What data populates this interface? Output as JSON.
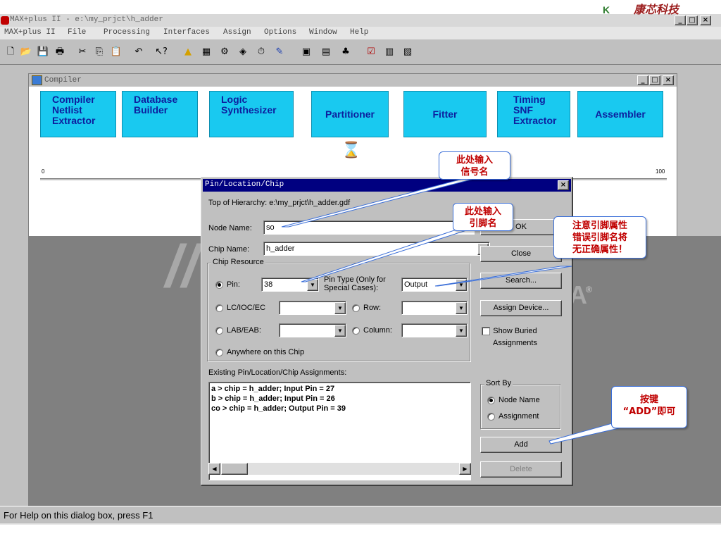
{
  "app": {
    "title": "MAX+plus II - e:\\my_prjct\\h_adder",
    "brand": "康芯科技",
    "brand_mark": "K"
  },
  "menu": [
    "MAX+plus II",
    "File",
    "Processing",
    "Interfaces",
    "Assign",
    "Options",
    "Window",
    "Help"
  ],
  "toolbar_icons": [
    {
      "name": "new-file-icon",
      "glyph": "🗋"
    },
    {
      "name": "open-folder-icon",
      "glyph": "📂"
    },
    {
      "name": "save-icon",
      "glyph": "💾"
    },
    {
      "name": "print-icon",
      "glyph": "🖶"
    },
    {
      "name": "cut-icon",
      "glyph": "✂"
    },
    {
      "name": "copy-icon",
      "glyph": "⎘"
    },
    {
      "name": "paste-icon",
      "glyph": "📋"
    },
    {
      "name": "undo-icon",
      "glyph": "↶"
    },
    {
      "name": "context-help-icon",
      "glyph": "↖?"
    },
    {
      "name": "hierarchy-icon",
      "glyph": "▲"
    },
    {
      "name": "floorplan-icon",
      "glyph": "▦"
    },
    {
      "name": "compiler-icon",
      "glyph": "⚙"
    },
    {
      "name": "simulator-icon",
      "glyph": "◈"
    },
    {
      "name": "timing-analyzer-icon",
      "glyph": "⏱"
    },
    {
      "name": "programmer-icon",
      "glyph": "✎"
    },
    {
      "name": "project-set-icon",
      "glyph": "▣"
    },
    {
      "name": "project-save-check-icon",
      "glyph": "▤"
    },
    {
      "name": "project-save-compile-icon",
      "glyph": "♣"
    },
    {
      "name": "project-save-simulate-icon",
      "glyph": "☑"
    },
    {
      "name": "project-open-icon",
      "glyph": "▥"
    },
    {
      "name": "project-close-icon",
      "glyph": "▧"
    }
  ],
  "compiler": {
    "title": "Compiler",
    "stages": [
      {
        "label": "Compiler\nNetlist\nExtractor"
      },
      {
        "label": "Database\nBuilder"
      },
      {
        "label": "Logic\nSynthesizer"
      },
      {
        "label": "Partitioner"
      },
      {
        "label": "Fitter"
      },
      {
        "label": "Timing\nSNF\nExtractor"
      },
      {
        "label": "Assembler"
      }
    ],
    "progress_min": "0",
    "progress_max": "100",
    "hourglass": "⌛"
  },
  "dialog": {
    "title": "Pin/Location/Chip",
    "top_of_hierarchy": "Top of Hierarchy:  e:\\my_prjct\\h_adder.gdf",
    "node_name_label": "Node Name:",
    "node_name_value": "so",
    "chip_name_label": "Chip Name:",
    "chip_name_value": "h_adder",
    "chip_resource_label": "Chip Resource",
    "pin_label": "Pin:",
    "pin_value": "38",
    "pin_type_label": "Pin Type (Only for\nSpecial Cases):",
    "pin_type_value": "Output",
    "lc_label": "LC/IOC/EC",
    "row_label": "Row:",
    "lab_label": "LAB/EAB:",
    "column_label": "Column:",
    "anywhere_label": "Anywhere on this Chip",
    "existing_label": "Existing Pin/Location/Chip Assignments:",
    "assignments": [
      "a > chip = h_adder; Input Pin = 27",
      "b > chip = h_adder; Input Pin = 26",
      "co > chip = h_adder; Output Pin = 39"
    ],
    "buttons": {
      "ok": "OK",
      "close": "Close",
      "search": "Search...",
      "assign_device": "Assign Device...",
      "add": "Add",
      "delete": "Delete"
    },
    "show_buried_label": "Show Buried\nAssignments",
    "sort_by_label": "Sort By",
    "sort_node_name": "Node Name",
    "sort_assignment": "Assignment"
  },
  "annotations": {
    "signal_name": "此处输入\n信号名",
    "pin_name": "此处输入\n引脚名",
    "warning": "注意引脚属性\n错误引脚名将\n无正确属性！",
    "add_hint": "按键\n“ADD”即可"
  },
  "status": {
    "text": "For Help on this dialog box, press F1"
  },
  "colors": {
    "stage_fill": "#19c9f0",
    "stage_text": "#0d1f9e",
    "dialog_title": "#000080",
    "annotation_text": "#c00000",
    "annotation_border": "#3b6fd8"
  }
}
